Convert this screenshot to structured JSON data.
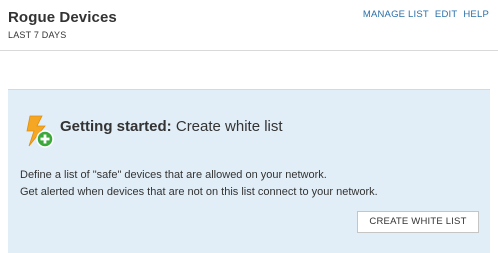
{
  "widget": {
    "title": "Rogue Devices",
    "subtitle": "LAST 7 DAYS",
    "links": {
      "manage_list": "MANAGE LIST",
      "edit": "EDIT",
      "help": "HELP"
    }
  },
  "getting_started": {
    "icon": "lightning-plus-icon",
    "heading_bold": "Getting started:",
    "heading_rest": " Create white list",
    "line1": "Define a list of \"safe\" devices that are allowed on your network.",
    "line2": "Get alerted when devices that are not on this list connect to your network.",
    "button_label": "CREATE WHITE LIST"
  },
  "colors": {
    "link": "#2a6fa8",
    "panel_bg": "#e2eef7",
    "bolt": "#f5a623",
    "plus_badge": "#3aa83a"
  }
}
